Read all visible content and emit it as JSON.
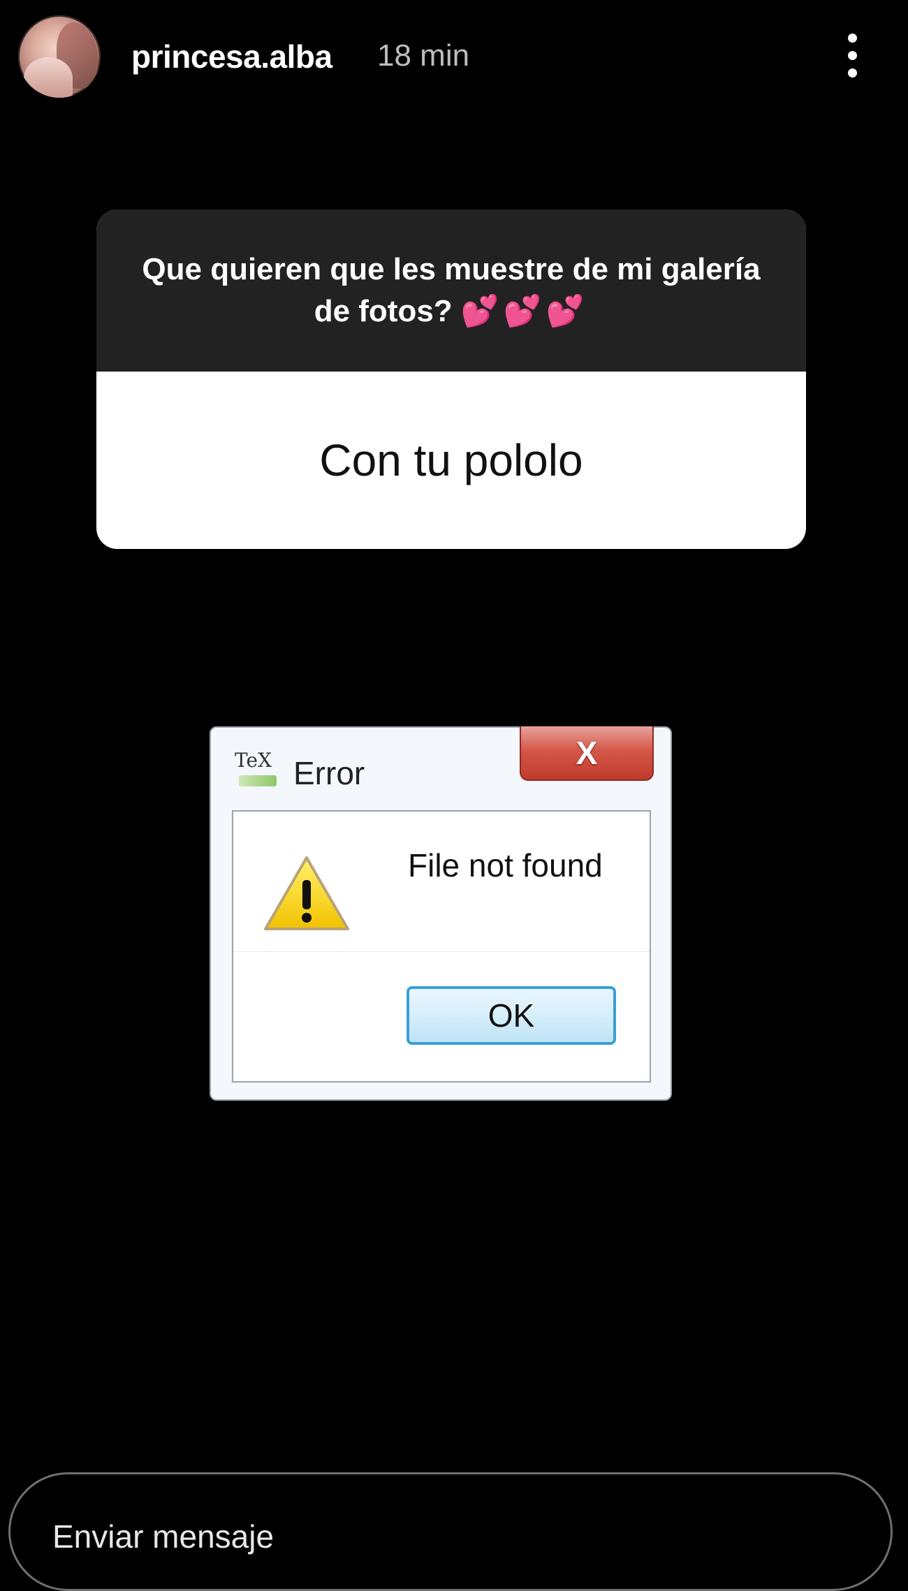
{
  "header": {
    "username": "princesa.alba",
    "time": "18 min"
  },
  "question_sticker": {
    "question": "Que quieren que les muestre de mi galería de fotos?",
    "hearts": "💕💕💕",
    "answer": "Con tu pololo"
  },
  "error_dialog": {
    "icon_label": "TeX",
    "title": "Error",
    "close_label": "X",
    "message": "File not found",
    "ok_label": "OK"
  },
  "message_bar": {
    "placeholder": "Enviar mensaje"
  },
  "colors": {
    "background": "#000000",
    "sticker_top": "#222222",
    "hearts": "#ff3fb4",
    "close_red": "#c13a2c",
    "ok_border": "#3c9fd6"
  }
}
